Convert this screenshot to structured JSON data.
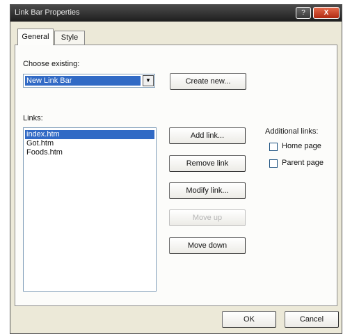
{
  "window": {
    "title": "Link Bar Properties",
    "help_glyph": "?",
    "close_glyph": "X"
  },
  "tabs": [
    {
      "label": "General",
      "selected": true
    },
    {
      "label": "Style",
      "selected": false
    }
  ],
  "choose_existing": {
    "label": "Choose existing:",
    "value": "New Link Bar",
    "arrow_glyph": "▼"
  },
  "buttons": {
    "create_new": "Create new...",
    "add_link": "Add link...",
    "remove_link": "Remove link",
    "modify_link": "Modify link...",
    "move_up": "Move up",
    "move_down": "Move down",
    "ok": "OK",
    "cancel": "Cancel"
  },
  "links": {
    "label": "Links:",
    "items": [
      "index.htm",
      "Got.htm",
      "Foods.htm"
    ],
    "selected_index": 0
  },
  "additional_links": {
    "label": "Additional links:",
    "options": [
      {
        "label": "Home page",
        "checked": false
      },
      {
        "label": "Parent page",
        "checked": false
      }
    ]
  },
  "colors": {
    "selection": "#316ac5",
    "title_bar": "#2a2a2a",
    "close_button": "#c8401f"
  }
}
